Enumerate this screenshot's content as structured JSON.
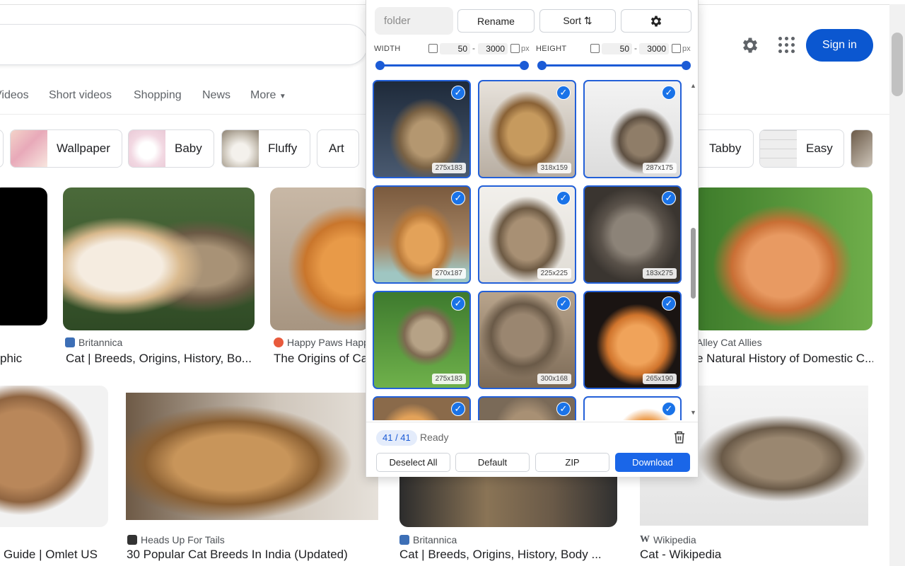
{
  "header": {
    "sign_in_label": "Sign in",
    "settings_icon": "gear-icon",
    "apps_icon": "apps-grid-icon"
  },
  "nav_tabs": [
    "Videos",
    "Short videos",
    "Shopping",
    "News",
    "More"
  ],
  "chips": [
    "Wallpaper",
    "Baby",
    "Fluffy",
    "Art",
    "Tabby",
    "Easy"
  ],
  "results_row1": [
    {
      "title": "phic"
    },
    {
      "source": "Britannica",
      "title": "Cat | Breeds, Origins, History, Bo..."
    },
    {
      "source": "Happy Paws Happ",
      "title": "The Origins of Cat"
    },
    {
      "source": "Alley Cat Allies",
      "title": "e Natural History of Domestic C..."
    }
  ],
  "results_row2": [
    {
      "title": "Guide | Omlet US"
    },
    {
      "source": "Heads Up For Tails",
      "title": "30 Popular Cat Breeds In India (Updated)"
    },
    {
      "source": "Britannica",
      "title": "Cat | Breeds, Origins, History, Body ..."
    },
    {
      "source": "Wikipedia",
      "title": "Cat - Wikipedia"
    }
  ],
  "popup": {
    "folder_placeholder": "folder",
    "rename_label": "Rename",
    "sort_label": "Sort ⇅",
    "settings_icon": "gear-icon",
    "width_label": "WIDTH",
    "height_label": "HEIGHT",
    "width_min": "50",
    "width_max": "3000",
    "height_min": "50",
    "height_max": "3000",
    "unit": "px",
    "tiles": [
      "275x183",
      "318x159",
      "287x175",
      "270x187",
      "225x225",
      "183x275",
      "275x183",
      "300x168",
      "265x190",
      "",
      "",
      ""
    ],
    "count": "41 / 41",
    "status": "Ready",
    "trash_icon": "trash-icon",
    "deselect_label": "Deselect All",
    "default_label": "Default",
    "zip_label": "ZIP",
    "download_label": "Download",
    "colors": {
      "accent": "#1b5bd6",
      "primary_button": "#1a66e8",
      "sign_in": "#0b57d0"
    }
  }
}
